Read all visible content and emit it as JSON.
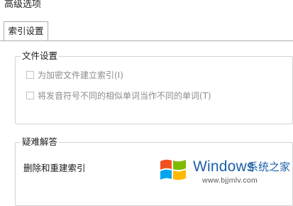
{
  "window": {
    "title": "高级选项"
  },
  "tabs": [
    {
      "label": "索引设置"
    }
  ],
  "file_settings": {
    "title": "文件设置",
    "options": [
      {
        "label": "为加密文件建立索引(I)",
        "checked": false,
        "enabled": false
      },
      {
        "label": "将发音符号不同的相似单词当作不同的单词(T)",
        "checked": false,
        "enabled": false
      }
    ]
  },
  "troubleshooting": {
    "title": "疑难解答",
    "action_label": "删除和重建索引"
  },
  "watermark": {
    "brand": "Windows",
    "site_name": "系统之家",
    "url": "www.bjjmlv.com",
    "colors": {
      "red": "#f25022",
      "green": "#7fba00",
      "blue": "#00a4ef",
      "yellow": "#ffb900"
    }
  }
}
